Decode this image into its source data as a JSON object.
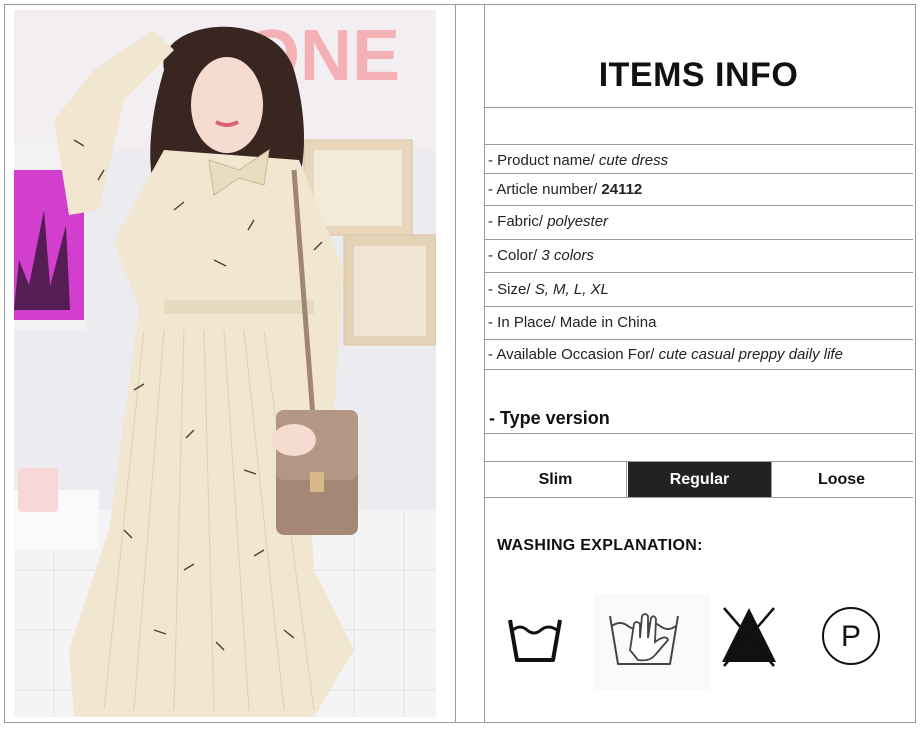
{
  "info": {
    "title": "ITEMS INFO",
    "rows": [
      {
        "label": "- Product name/",
        "value": "cute dress",
        "bold": false
      },
      {
        "label": "- Article number/",
        "value": "24112",
        "bold": true
      },
      {
        "label": "- Fabric/",
        "value": "polyester",
        "bold": false
      },
      {
        "label": "- Color/",
        "value": "3 colors",
        "bold": false
      },
      {
        "label": "- Size/",
        "value": "S, M, L, XL",
        "bold": false
      },
      {
        "label": "- In Place/ Made in China",
        "value": "",
        "bold": false
      },
      {
        "label": "- Available Occasion For/",
        "value": "cute casual preppy daily life",
        "bold": false
      }
    ],
    "type_version": "- Type version",
    "fit_options": [
      "Slim",
      "Regular",
      "Loose"
    ],
    "fit_selected": "Regular"
  },
  "washing": {
    "title": "WASHING EXPLANATION:",
    "icons": [
      "washing-tub-icon",
      "hand-wash-icon",
      "do-not-bleach-icon",
      "dry-clean-p-icon"
    ],
    "dry_clean_letter": "P"
  },
  "photo": {
    "wall_sign": "ONE"
  },
  "colors": {
    "border": "#9a9a9a",
    "selected_bg": "#222222",
    "selected_text": "#ffffff"
  }
}
